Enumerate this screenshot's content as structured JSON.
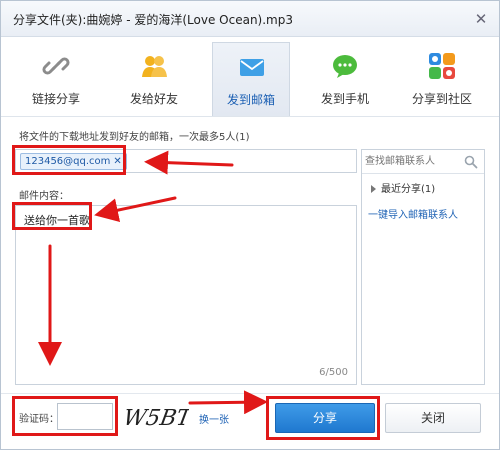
{
  "window": {
    "title": "分享文件(夹):曲婉婷 - 爱的海洋(Love Ocean).mp3",
    "close_glyph": "✕"
  },
  "tabs": [
    {
      "label": "链接分享",
      "icon": "link-icon"
    },
    {
      "label": "发给好友",
      "icon": "friends-icon"
    },
    {
      "label": "发到邮箱",
      "icon": "mail-icon",
      "active": true
    },
    {
      "label": "发到手机",
      "icon": "phone-message-icon"
    },
    {
      "label": "分享到社区",
      "icon": "community-icon"
    }
  ],
  "email": {
    "hint": "将文件的下载地址发到好友的邮箱，一次最多5人(1)",
    "recipient": "123456@qq.com",
    "remove_glyph": "✕"
  },
  "contacts": {
    "search_placeholder": "查找邮箱联系人",
    "recent_label": "最近分享(1)",
    "import_link": "一键导入邮箱联系人"
  },
  "message": {
    "label": "邮件内容：",
    "text": "送给你一首歌",
    "counter": "6/500"
  },
  "captcha": {
    "label": "验证码：",
    "input_value": "",
    "image_text": "W5BT",
    "refresh_link": "换一张"
  },
  "buttons": {
    "share": "分享",
    "close": "关闭"
  },
  "colors": {
    "accent": "#1f78cf",
    "highlight": "#e01818",
    "link": "#1f63b5"
  }
}
